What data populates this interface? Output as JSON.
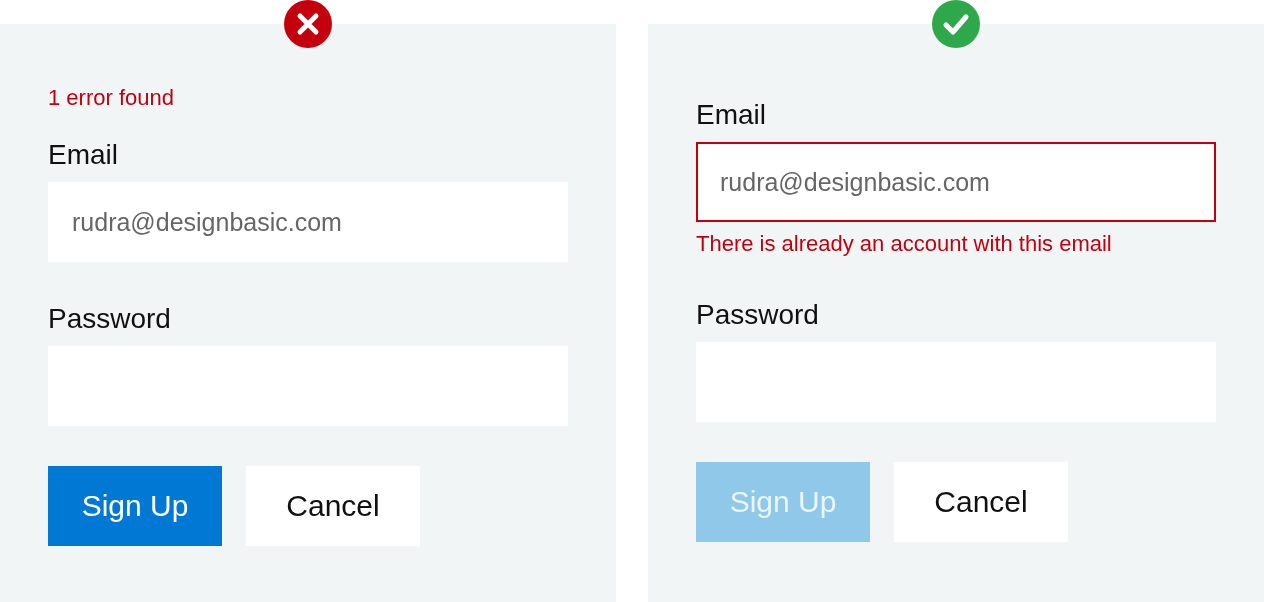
{
  "panels": [
    {
      "valid": false,
      "error_summary": "1 error found",
      "fields": [
        {
          "label": "Email",
          "value": "rudra@designbasic.com",
          "invalid": false
        },
        {
          "label": "Password",
          "invalid": false
        }
      ],
      "buttons": [
        {
          "kind": "primary",
          "label": "Sign Up",
          "disabled": false
        },
        {
          "kind": "secondary",
          "label": "Cancel",
          "disabled": false
        }
      ]
    },
    {
      "valid": true,
      "fields": [
        {
          "label": "Email",
          "value": "rudra@designbasic.com",
          "invalid": true,
          "error": "There is already an account with this email"
        },
        {
          "label": "Password",
          "invalid": false
        }
      ],
      "buttons": [
        {
          "kind": "primary",
          "label": "Sign Up",
          "disabled": true
        },
        {
          "kind": "secondary",
          "label": "Cancel",
          "disabled": false
        }
      ]
    }
  ]
}
